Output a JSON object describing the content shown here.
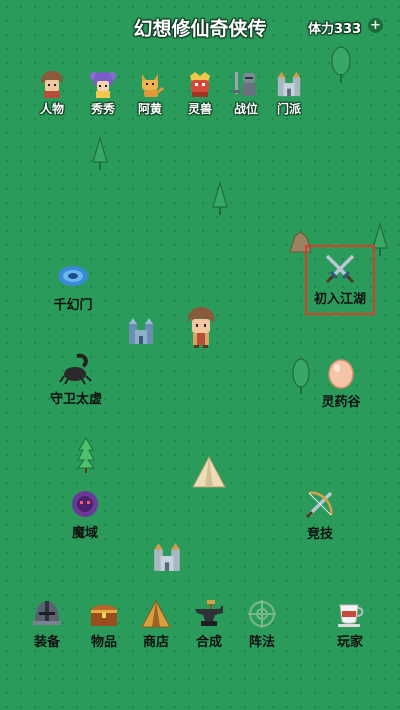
{
  "header": {
    "title": "幻想修仙奇侠传",
    "stamina_label": "体力333",
    "add_symbol": "+"
  },
  "top_nav": [
    {
      "label": "人物",
      "icon": "hero-portrait-icon"
    },
    {
      "label": "秀秀",
      "icon": "girl-portrait-icon"
    },
    {
      "label": "阿黄",
      "icon": "dog-icon"
    },
    {
      "label": "灵兽",
      "icon": "spirit-beast-icon"
    },
    {
      "label": "战位",
      "icon": "knight-armor-icon"
    },
    {
      "label": "门派",
      "icon": "castle-icon"
    }
  ],
  "map_nodes": [
    {
      "label": "千幻门",
      "icon": "blue-vortex-icon"
    },
    {
      "label": "初入江湖",
      "icon": "crossed-swords-icon",
      "highlighted": true
    },
    {
      "label": "守卫太虚",
      "icon": "black-scorpion-icon"
    },
    {
      "label": "灵药谷",
      "icon": "egg-icon"
    },
    {
      "label": "魔域",
      "icon": "purple-demon-icon"
    },
    {
      "label": "竞技",
      "icon": "sword-bow-icon"
    }
  ],
  "bottom_nav": [
    {
      "label": "装备",
      "icon": "helmet-icon"
    },
    {
      "label": "物品",
      "icon": "treasure-chest-icon"
    },
    {
      "label": "商店",
      "icon": "tent-icon"
    },
    {
      "label": "合成",
      "icon": "anvil-icon"
    },
    {
      "label": "阵法",
      "icon": "formation-icon"
    },
    {
      "label": "玩家",
      "icon": "teacup-icon"
    }
  ],
  "colors": {
    "background": "#2a9b5a",
    "highlight_border": "#e03a2a"
  }
}
